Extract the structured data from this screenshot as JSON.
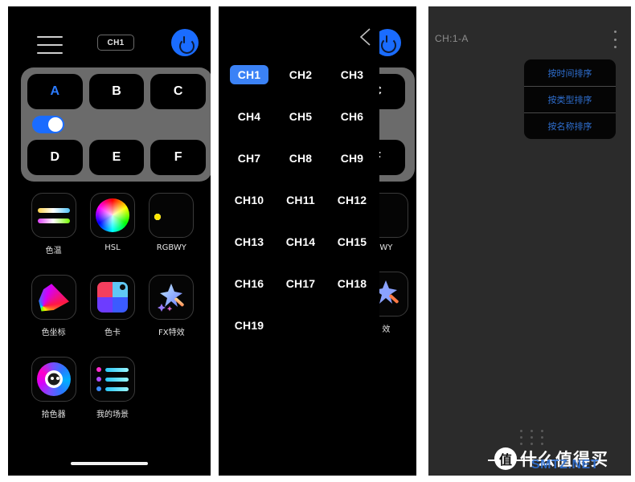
{
  "app": {
    "title": "Lighting Control App — three screens"
  },
  "panel1": {
    "name": "main-control-screen",
    "header": {
      "menu_icon": "hamburger-menu-icon",
      "channel_chip": "CH1",
      "power_icon": "power-icon"
    },
    "pad": {
      "keys_top": [
        "A",
        "B",
        "C"
      ],
      "keys_bottom": [
        "D",
        "E",
        "F"
      ],
      "active_key": "A",
      "toggle_state": "on"
    },
    "tools": [
      {
        "label": "色温",
        "icon": "color-temperature-icon"
      },
      {
        "label": "HSL",
        "icon": "hsl-color-wheel-icon"
      },
      {
        "label": "RGBWY",
        "icon": "rgbwy-sliders-icon"
      },
      {
        "label": "色坐标",
        "icon": "cie-coordinate-icon"
      },
      {
        "label": "色卡",
        "icon": "color-card-icon"
      },
      {
        "label": "FX特效",
        "icon": "fx-effects-icon"
      },
      {
        "label": "拾色器",
        "icon": "color-picker-icon"
      },
      {
        "label": "我的场景",
        "icon": "my-scenes-list-icon"
      }
    ]
  },
  "panel2": {
    "name": "channel-picker-screen",
    "back_icon": "back-chevron-icon",
    "selected_channel": "CH1",
    "channels": [
      "CH1",
      "CH2",
      "CH3",
      "CH4",
      "CH5",
      "CH6",
      "CH7",
      "CH8",
      "CH9",
      "CH10",
      "CH11",
      "CH12",
      "CH13",
      "CH14",
      "CH15",
      "CH16",
      "CH17",
      "CH18",
      "CH19"
    ],
    "underlay": {
      "pad_keys": [
        "C",
        "F"
      ],
      "tool_labels": [
        "WY",
        "效"
      ],
      "power_icon": "power-icon"
    }
  },
  "panel3": {
    "name": "scene-list-screen",
    "title": "CH:1-A",
    "kebab_icon": "more-vertical-icon",
    "sort_menu": [
      "按时间排序",
      "按类型排序",
      "按名称排序"
    ]
  },
  "watermark": {
    "badge": "值",
    "text": "什么值得买",
    "net": "SMTZ.NET",
    "dots_icon": "dot-grid-icon"
  },
  "colors": {
    "accent_blue": "#1a6cff",
    "selected_blue": "#3b82f6",
    "menu_text_blue": "#2f6fd0",
    "pad_gray": "#6b6b6b",
    "panel3_bg": "#2b2b2b"
  }
}
